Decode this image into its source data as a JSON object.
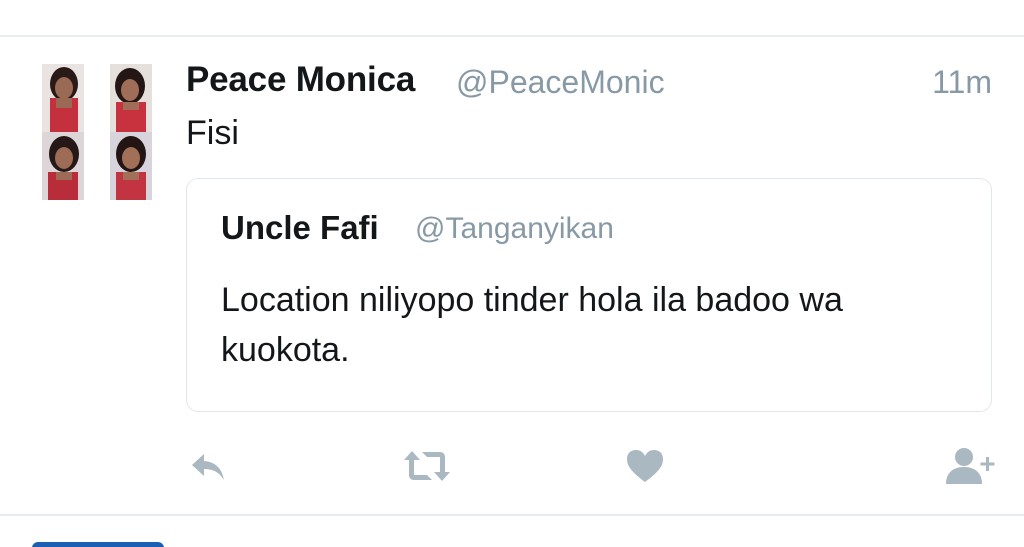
{
  "tweet": {
    "author": {
      "name": "Peace Monica",
      "handle": "@PeaceMonic"
    },
    "timestamp": "11m",
    "text": "Fisi",
    "quoted": {
      "author": {
        "name": "Uncle Fafi",
        "handle": "@Tanganyikan"
      },
      "text": "Location niliyopo tinder hola ila badoo wa kuokota."
    },
    "actions": [
      {
        "icon": "reply-icon"
      },
      {
        "icon": "retweet-icon"
      },
      {
        "icon": "like-icon"
      },
      {
        "icon": "follow-icon"
      }
    ]
  },
  "colors": {
    "text_primary": "#14171a",
    "text_secondary": "#8899a6",
    "action_icon": "#aab8c2",
    "divider": "#e6ecf0",
    "accent": "#1da1f2"
  }
}
